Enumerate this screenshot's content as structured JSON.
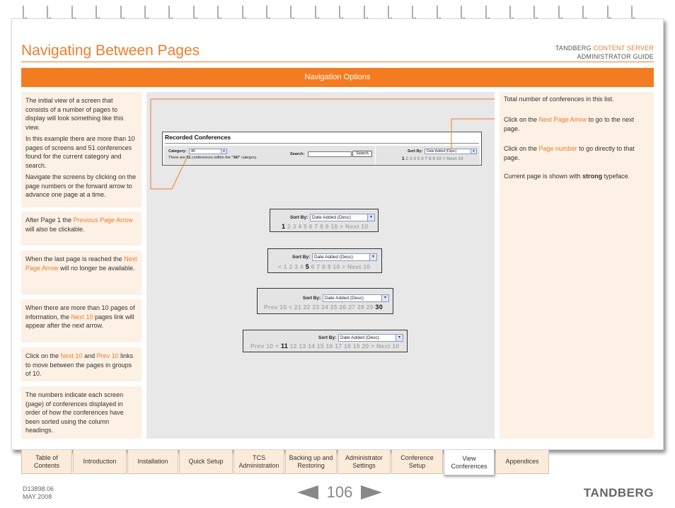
{
  "header": {
    "title": "Navigating Between Pages",
    "brand_line1_prefix": "TANDBERG ",
    "brand_line1_accent": "CONTENT SERVER",
    "brand_line2": "ADMINISTRATOR GUIDE",
    "section_bar": "Navigation Options"
  },
  "colors": {
    "accent": "#f47c20",
    "panel_bg": "#fdf0e4",
    "center_bg": "#e8e8e8"
  },
  "left_notes": {
    "n1_p1": "The initial view of a screen that consists of a number of pages to display will look something like this view.",
    "n1_p2": "In this example there are more than 10 pages of screens and 51 conferences found for the current category and search.",
    "n1_p3": "Navigate the screens by clicking on the page numbers or the forward arrow to advance one page at a time.",
    "n2_a": "After Page 1 the ",
    "n2_link": "Previous Page Arrow",
    "n2_b": " will also be clickable.",
    "n3_a": "When the last page is reached the ",
    "n3_link": "Next Page Arrow",
    "n3_b": " will no longer be available.",
    "n4_a": "When there are more than 10 pages of information, the ",
    "n4_link": "Next 10",
    "n4_b": " pages link will appear after the next arrow.",
    "n5_a": "Click on the ",
    "n5_link1": "Next 10",
    "n5_mid": " and ",
    "n5_link2": "Prev 10",
    "n5_b": " links to move between the pages in groups of 10.",
    "n6": "The numbers indicate each screen (page) of conferences displayed in order of how the conferences have been sorted using the column headings."
  },
  "right_notes": {
    "r1": "Total number of conferences in this list.",
    "r2_a": "Click on the ",
    "r2_link": "Next Page Arrow",
    "r2_b": " to go to the next page.",
    "r3_a": "Click on the ",
    "r3_link": "Page number",
    "r3_b": " to go directly to that page.",
    "r4_a": "Current page is shown with ",
    "r4_strong": "strong",
    "r4_b": " typeface."
  },
  "recorded": {
    "title": "Recorded Conferences",
    "category_label": "Category:",
    "category_value": "All",
    "count_a": "There are ",
    "count_num": "51",
    "count_b": " conferences within the ",
    "count_cat": "\"All\"",
    "count_c": " category.",
    "search_label": "Search:",
    "search_button": "Search",
    "sort_label": "Sort By:",
    "sort_value": "Date Added (Desc)",
    "pager_cur": "1",
    "pager_rest": " 2 3 4 5 6 7 8 9 10 > Next 10"
  },
  "sort_examples": {
    "sort_label": "Sort By:",
    "sort_value": "Date Added (Desc)",
    "ex1_pre": "",
    "ex1_cur": "1",
    "ex1_post": " 2 3 4 5 6 7 8 9 10 > Next 10",
    "ex2_pre": "< 1 2 3 4 ",
    "ex2_cur": "5",
    "ex2_post": " 6 7 8 9 10 > Next 10",
    "ex3_pre": "Prev 10 < 21 22 23 24 25 26 27 28 29 ",
    "ex3_cur": "30",
    "ex3_post": "",
    "ex4_pre": "Prev 10 < ",
    "ex4_cur": "11",
    "ex4_post": " 12 13 14 15 16 17 18 19 20 > Next 10"
  },
  "tabs": [
    {
      "line1": "Table of",
      "line2": "Contents"
    },
    {
      "line1": "Introduction",
      "line2": ""
    },
    {
      "line1": "Installation",
      "line2": ""
    },
    {
      "line1": "Quick Setup",
      "line2": ""
    },
    {
      "line1": "TCS",
      "line2": "Administration"
    },
    {
      "line1": "Backing up and",
      "line2": "Restoring"
    },
    {
      "line1": "Administrator",
      "line2": "Settings"
    },
    {
      "line1": "Conference",
      "line2": "Setup"
    },
    {
      "line1": "View",
      "line2": "Conferences"
    },
    {
      "line1": "Appendices",
      "line2": ""
    }
  ],
  "footer": {
    "doc_number": "D13898.06",
    "doc_date": "MAY 2008",
    "page_number": "106",
    "logo": "TANDBERG"
  }
}
